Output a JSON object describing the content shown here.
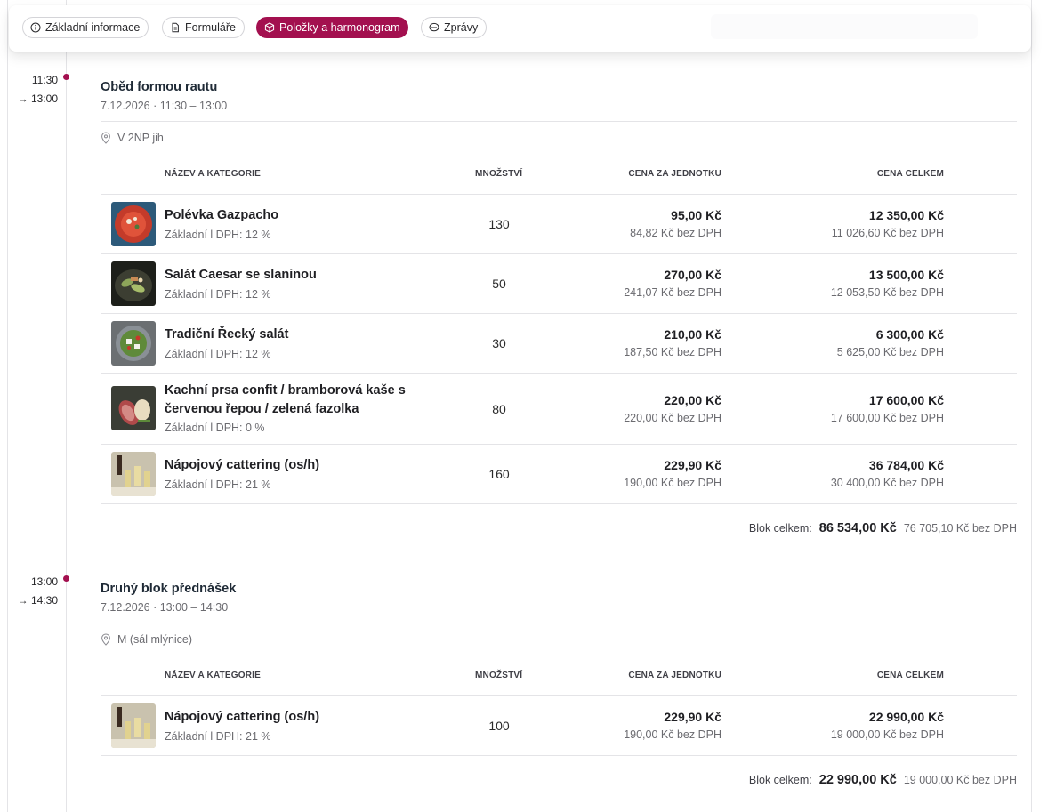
{
  "tabs": [
    {
      "label": "Základní informace",
      "icon": "info-icon",
      "active": false
    },
    {
      "label": "Formuláře",
      "icon": "document-icon",
      "active": false
    },
    {
      "label": "Položky a harmonogram",
      "icon": "box-icon",
      "active": true
    },
    {
      "label": "Zprávy",
      "icon": "chat-icon",
      "active": false
    }
  ],
  "columns": {
    "name": "NÁZEV A KATEGORIE",
    "qty": "MNOŽSTVÍ",
    "unit_price": "CENA ZA JEDNOTKU",
    "total": "CENA CELKEM"
  },
  "blocks": [
    {
      "time_start": "11:30",
      "time_end": "→ 13:00",
      "title": "Oběd formou rautu",
      "subtitle": "7.12.2026 · 11:30 – 13:00",
      "location": "V 2NP jih",
      "items": [
        {
          "name": "Polévka Gazpacho",
          "category": "Základní l  DPH: 12 %",
          "qty": "130",
          "unit_price": "95,00 Kč",
          "unit_net": "84,82 Kč bez DPH",
          "total": "12 350,00 Kč",
          "total_net": "11 026,60 Kč bez DPH"
        },
        {
          "name": "Salát Caesar se slaninou",
          "category": "Základní l  DPH: 12 %",
          "qty": "50",
          "unit_price": "270,00 Kč",
          "unit_net": "241,07 Kč bez DPH",
          "total": "13 500,00 Kč",
          "total_net": "12 053,50 Kč bez DPH"
        },
        {
          "name": "Tradiční Řecký salát",
          "category": "Základní l  DPH: 12 %",
          "qty": "30",
          "unit_price": "210,00 Kč",
          "unit_net": "187,50 Kč bez DPH",
          "total": "6 300,00 Kč",
          "total_net": "5 625,00 Kč bez DPH"
        },
        {
          "name": "Kachní prsa confit / bramborová kaše s červenou řepou / zelená fazolka",
          "category": "Základní l  DPH: 0 %",
          "qty": "80",
          "unit_price": "220,00 Kč",
          "unit_net": "220,00 Kč bez DPH",
          "total": "17 600,00 Kč",
          "total_net": "17 600,00 Kč bez DPH"
        },
        {
          "name": "Nápojový cattering (os/h)",
          "category": "Základní l  DPH: 21 %",
          "qty": "160",
          "unit_price": "229,90 Kč",
          "unit_net": "190,00 Kč bez DPH",
          "total": "36 784,00 Kč",
          "total_net": "30 400,00 Kč bez DPH"
        }
      ],
      "sum_label": "Blok celkem:",
      "sum_total": "86 534,00 Kč",
      "sum_net": "76 705,10 Kč bez DPH"
    },
    {
      "time_start": "13:00",
      "time_end": "→ 14:30",
      "title": "Druhý blok přednášek",
      "subtitle": "7.12.2026 · 13:00 – 14:30",
      "location": "M (sál mlýnice)",
      "items": [
        {
          "name": "Nápojový cattering (os/h)",
          "category": "Základní l  DPH: 21 %",
          "qty": "100",
          "unit_price": "229,90 Kč",
          "unit_net": "190,00 Kč bez DPH",
          "total": "22 990,00 Kč",
          "total_net": "19 000,00 Kč bez DPH"
        }
      ],
      "sum_label": "Blok celkem:",
      "sum_total": "22 990,00 Kč",
      "sum_net": "19 000,00 Kč bez DPH"
    }
  ],
  "colors": {
    "accent": "#a3104f",
    "border": "#e4e4e7",
    "muted": "#6b6b70"
  }
}
